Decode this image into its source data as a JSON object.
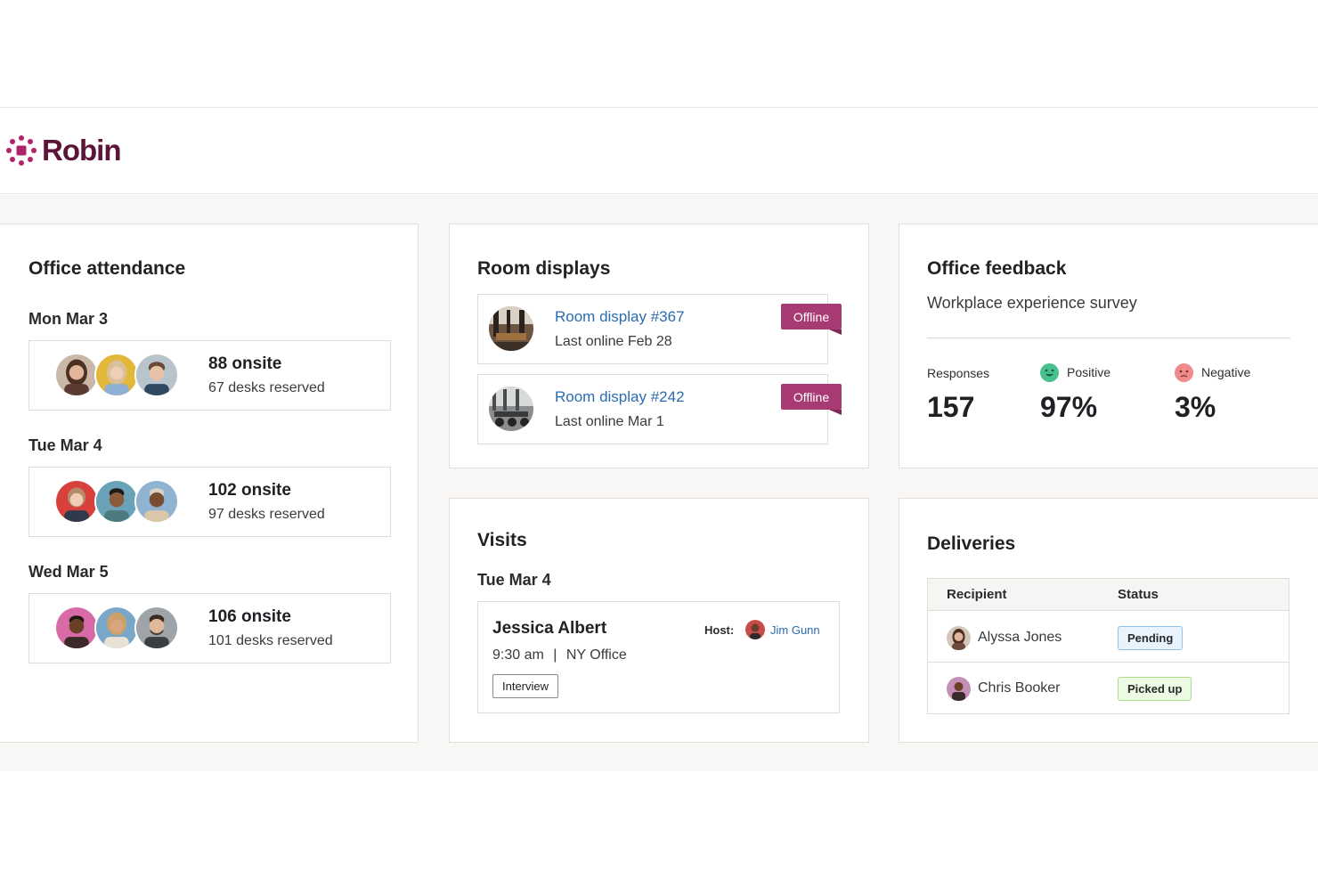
{
  "header": {
    "brand": "Robin",
    "brand_color": "#5c1438"
  },
  "attendance": {
    "title": "Office attendance",
    "days": [
      {
        "date": "Mon Mar 3",
        "onsite": "88 onsite",
        "reserved": "67 desks reserved"
      },
      {
        "date": "Tue Mar 4",
        "onsite": "102 onsite",
        "reserved": "97 desks reserved"
      },
      {
        "date": "Wed Mar 5",
        "onsite": "106 onsite",
        "reserved": "101 desks reserved"
      }
    ]
  },
  "room_displays": {
    "title": "Room displays",
    "items": [
      {
        "name": "Room display #367",
        "last_online": "Last online Feb 28",
        "status": "Offline"
      },
      {
        "name": "Room display #242",
        "last_online": "Last online Mar 1",
        "status": "Offline"
      }
    ]
  },
  "feedback": {
    "title": "Office feedback",
    "subtitle": "Workplace experience survey",
    "stats": [
      {
        "label": "Responses",
        "value": "157"
      },
      {
        "label": "Positive",
        "value": "97%",
        "icon": "smile-face-icon"
      },
      {
        "label": "Negative",
        "value": "3%",
        "icon": "frown-face-icon"
      }
    ]
  },
  "visits": {
    "title": "Visits",
    "date": "Tue Mar 4",
    "visitor": "Jessica Albert",
    "time": "9:30 am",
    "separator": "|",
    "location": "NY Office",
    "host_label": "Host:",
    "host_name": "Jim Gunn",
    "tag": "Interview"
  },
  "deliveries": {
    "title": "Deliveries",
    "columns": [
      "Recipient",
      "Status"
    ],
    "rows": [
      {
        "recipient": "Alyssa Jones",
        "status": "Pending"
      },
      {
        "recipient": "Chris Booker",
        "status": "Picked up"
      }
    ]
  },
  "colors": {
    "accent_link": "#2b6cb0",
    "offline_badge": "#a83b73",
    "positive": "#49c18f",
    "negative": "#ef8b8b"
  }
}
